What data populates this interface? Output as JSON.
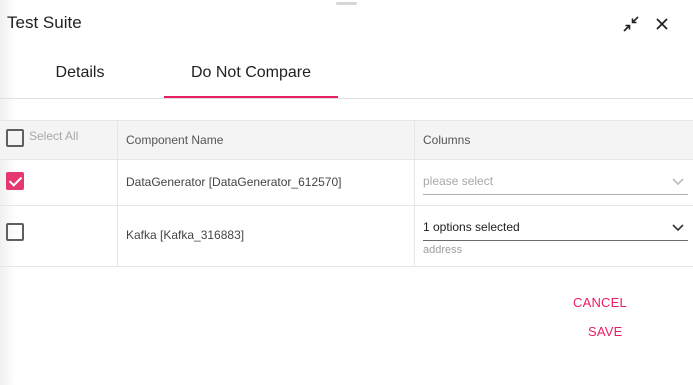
{
  "dialog": {
    "title": "Test Suite",
    "icons": {
      "collapse": "collapse-arrows-icon",
      "close": "close-icon"
    }
  },
  "tabs": [
    {
      "label": "Details",
      "active": false
    },
    {
      "label": "Do Not Compare",
      "active": true
    }
  ],
  "table": {
    "select_all_label": "Select All",
    "select_all_checked": false,
    "headers": {
      "name": "Component Name",
      "columns": "Columns"
    },
    "rows": [
      {
        "checked": true,
        "name": "DataGenerator [DataGenerator_612570]",
        "columns_placeholder": "please select",
        "columns_value": "",
        "hint": ""
      },
      {
        "checked": false,
        "name": "Kafka [Kafka_316883]",
        "columns_placeholder": "",
        "columns_value": "1 options selected",
        "hint": "address"
      }
    ]
  },
  "actions": {
    "cancel": "CANCEL",
    "save": "SAVE"
  },
  "colors": {
    "accent": "#e91e63",
    "checkbox_checked": "#e5386e"
  }
}
